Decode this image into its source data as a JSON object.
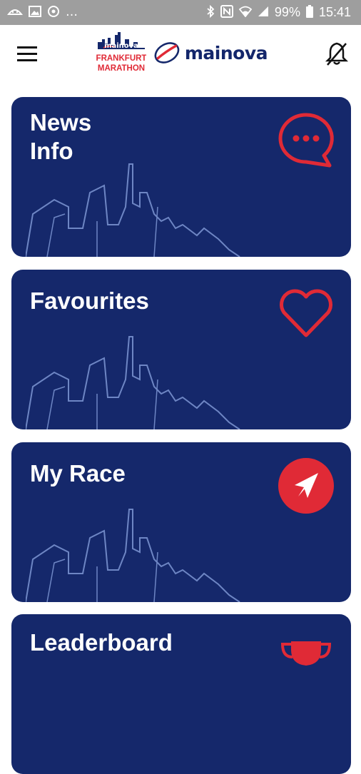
{
  "status_bar": {
    "battery": "99%",
    "time": "15:41",
    "left_icons": [
      "android-debug-icon",
      "image-icon",
      "sync-icon",
      "more-dots"
    ],
    "right_icons": [
      "bluetooth-icon",
      "nfc-icon",
      "wifi-icon",
      "signal-icon",
      "battery-icon"
    ]
  },
  "header": {
    "logo_mainova_text": "mainova",
    "marathon_logo_lines": [
      "mainova",
      "FRANKFURT",
      "MARATHON"
    ]
  },
  "cards": [
    {
      "id": "news-info",
      "title_lines": [
        "News",
        "Info"
      ],
      "icon": "chat-bubble-icon"
    },
    {
      "id": "favourites",
      "title_lines": [
        "Favourites"
      ],
      "icon": "heart-icon"
    },
    {
      "id": "my-race",
      "title_lines": [
        "My Race"
      ],
      "icon": "navigation-arrow-icon"
    },
    {
      "id": "leaderboard",
      "title_lines": [
        "Leaderboard"
      ],
      "icon": "trophy-icon"
    }
  ],
  "colors": {
    "card_background": "#15286b",
    "accent_red": "#e02a36",
    "skyline": "#6e86c4",
    "status_bar": "#9e9e9e"
  }
}
